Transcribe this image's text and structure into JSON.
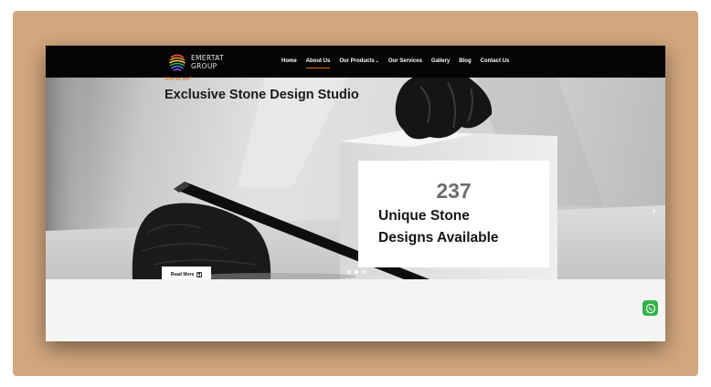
{
  "brand": {
    "line1": "EMERTAT",
    "line2": "GROUP"
  },
  "nav": {
    "items": [
      {
        "label": "Home"
      },
      {
        "label": "About Us"
      },
      {
        "label": "Our Products"
      },
      {
        "label": "Our Services"
      },
      {
        "label": "Gallery"
      },
      {
        "label": "Blog"
      },
      {
        "label": "Contact Us"
      }
    ],
    "active": "About Us"
  },
  "hero": {
    "stat_number": "237",
    "stat_line1": "Unique Stone",
    "stat_line2": "Designs Available",
    "read_more_label": "Read More",
    "slides_count": 3,
    "active_slide": 2
  },
  "about": {
    "eyebrow": "Who we are?",
    "title": "Exclusive Stone Design Studio"
  },
  "colors": {
    "accent": "#d96a1c",
    "frame": "#d3a77e",
    "navbar": "#050505",
    "whatsapp": "#35b24a"
  },
  "icons": {
    "logo": "rainbow-sphere-logo-icon",
    "next": "chevron-right-icon",
    "read_more": "document-icon",
    "chat": "whatsapp-icon"
  }
}
